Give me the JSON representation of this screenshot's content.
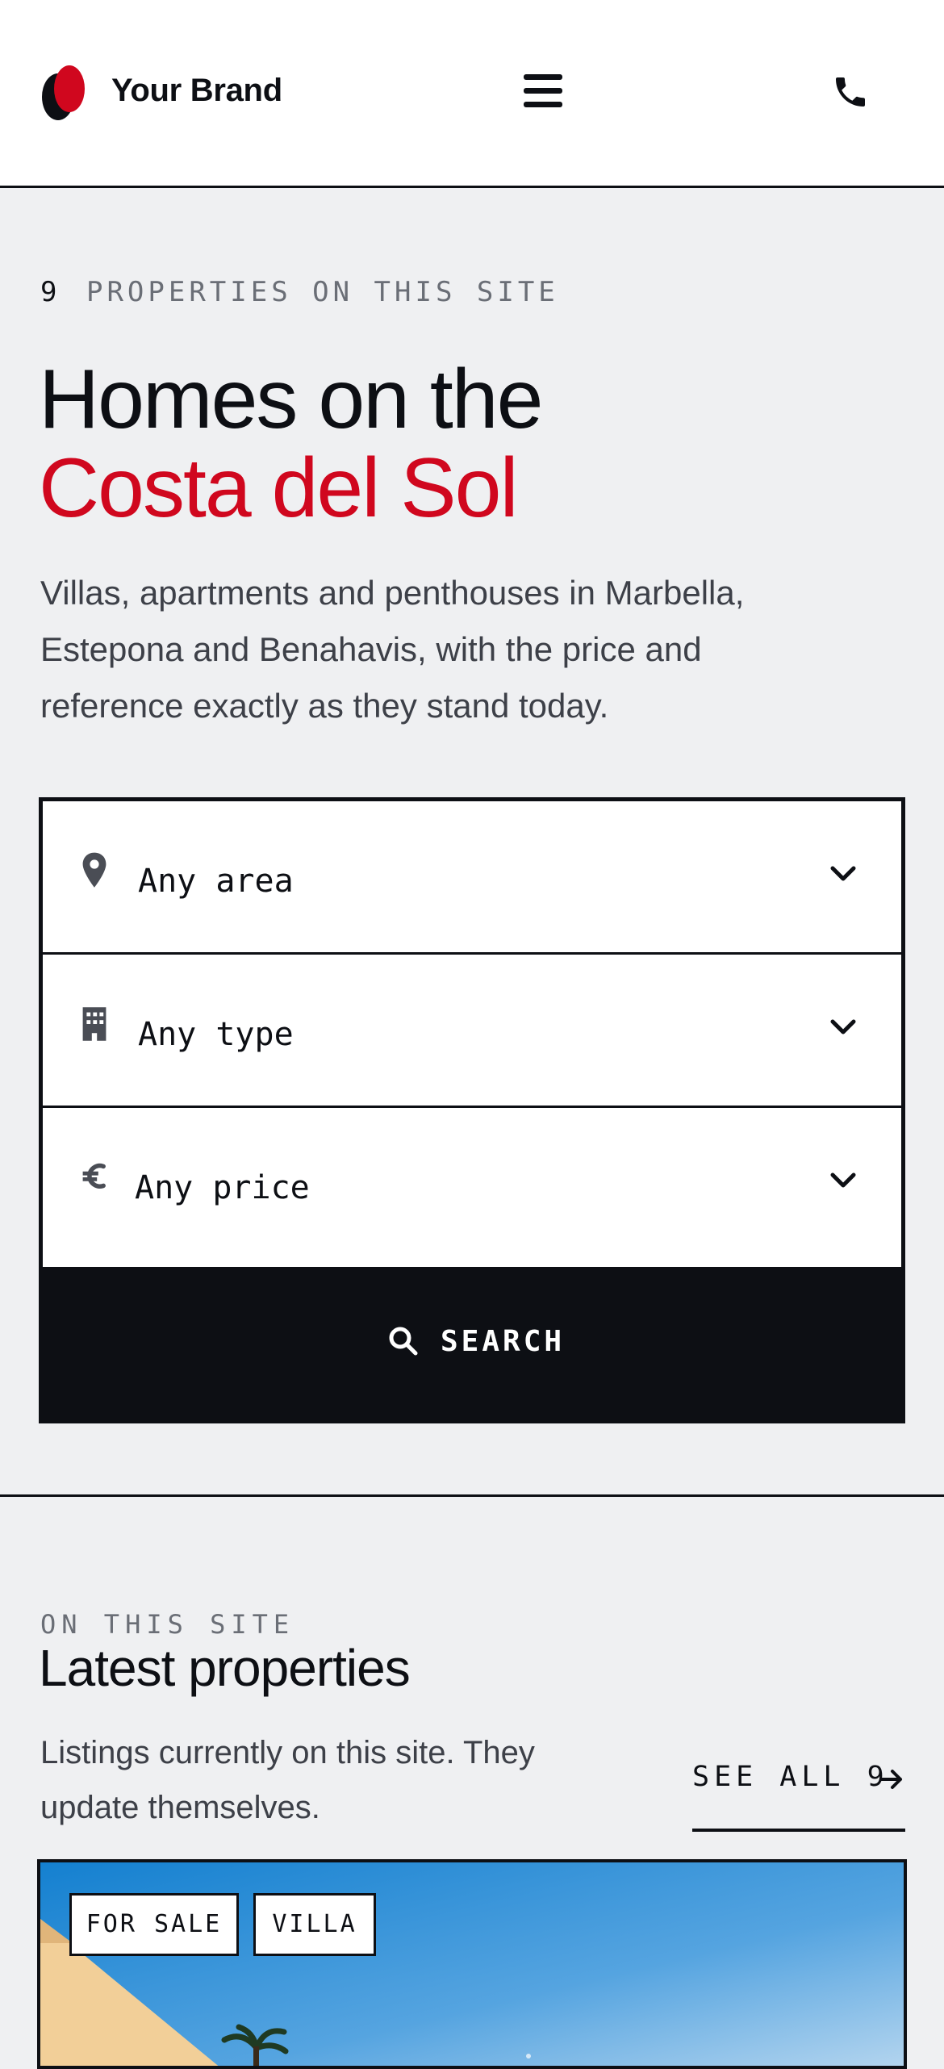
{
  "header": {
    "brand": "Your Brand",
    "logo_icon": "brand-logo-icon",
    "menu_icon": "hamburger-menu-icon",
    "phone_icon": "phone-icon"
  },
  "hero": {
    "count": "9",
    "eyebrow": "PROPERTIES ON THIS SITE",
    "title_line1": "Homes on the",
    "title_line2": "Costa del Sol",
    "intro": "Villas, apartments and penthouses in Marbella, Estepona and Benahavis, with the price and reference exactly as they stand today."
  },
  "search": {
    "fields": [
      {
        "label": "Any area",
        "icon": "location-pin-icon"
      },
      {
        "label": "Any type",
        "icon": "building-icon"
      },
      {
        "label": "Any price",
        "icon": "euro-icon"
      }
    ],
    "button_label": "SEARCH",
    "button_icon": "search-icon"
  },
  "latest": {
    "eyebrow": "ON THIS SITE",
    "title": "Latest properties",
    "description": "Listings currently on this site. They update themselves.",
    "see_all": "SEE ALL 9",
    "card": {
      "badges": [
        "FOR SALE",
        "VILLA"
      ]
    }
  },
  "colors": {
    "accent": "#d0071e",
    "ink": "#0d0f14",
    "background": "#eff0f2"
  }
}
